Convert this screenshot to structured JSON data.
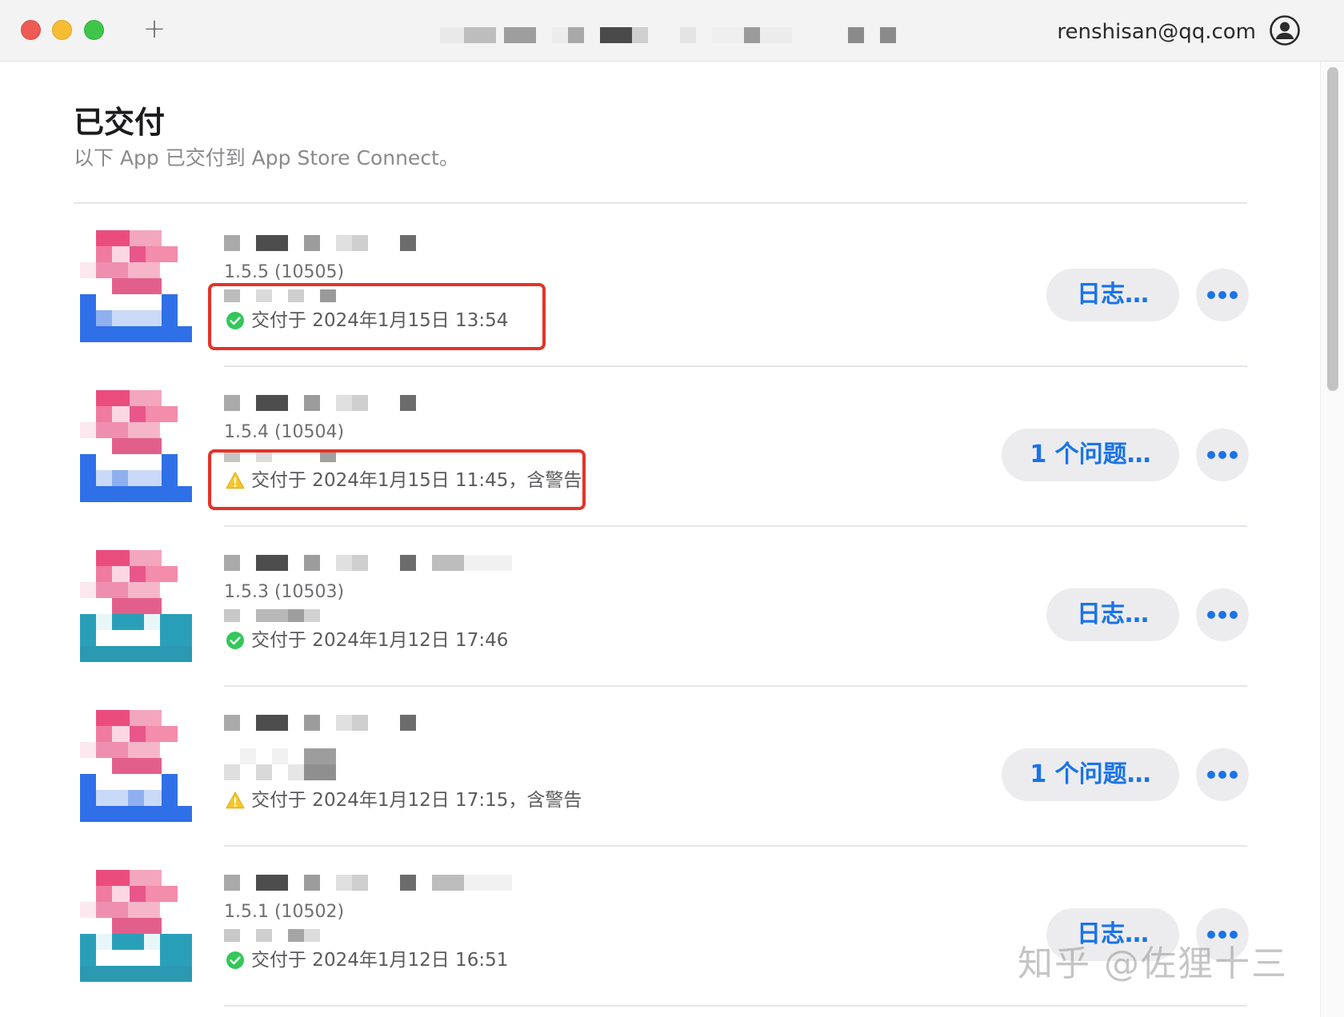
{
  "titlebar": {
    "new_tab_label": "+",
    "account_email": "renshisan@qq.com"
  },
  "header": {
    "title": "已交付",
    "subtitle": "以下 App 已交付到 App Store Connect。"
  },
  "rows": [
    {
      "version": "1.5.5 (10505)",
      "status_type": "success",
      "status_text": "交付于 2024年1月15日 13:54",
      "action_label": "日志…",
      "more_label": "•••",
      "icon_variant": "blue"
    },
    {
      "version": "1.5.4 (10504)",
      "status_type": "warning",
      "status_text": "交付于 2024年1月15日 11:45，含警告",
      "action_label": "1 个问题…",
      "more_label": "•••",
      "icon_variant": "blue"
    },
    {
      "version": "1.5.3 (10503)",
      "status_type": "success",
      "status_text": "交付于 2024年1月12日 17:46",
      "action_label": "日志…",
      "more_label": "•••",
      "icon_variant": "teal"
    },
    {
      "version": "",
      "status_type": "warning",
      "status_text": "交付于 2024年1月12日 17:15，含警告",
      "action_label": "1 个问题…",
      "more_label": "•••",
      "icon_variant": "blue"
    },
    {
      "version": "1.5.1 (10502)",
      "status_type": "success",
      "status_text": "交付于 2024年1月12日 16:51",
      "action_label": "日志…",
      "more_label": "•••",
      "icon_variant": "teal"
    }
  ],
  "watermark": "知乎 @佐狸十三",
  "colors": {
    "accent": "#1a73e8",
    "success": "#34c759",
    "warning": "#f7c52b",
    "highlight": "#e53228"
  }
}
